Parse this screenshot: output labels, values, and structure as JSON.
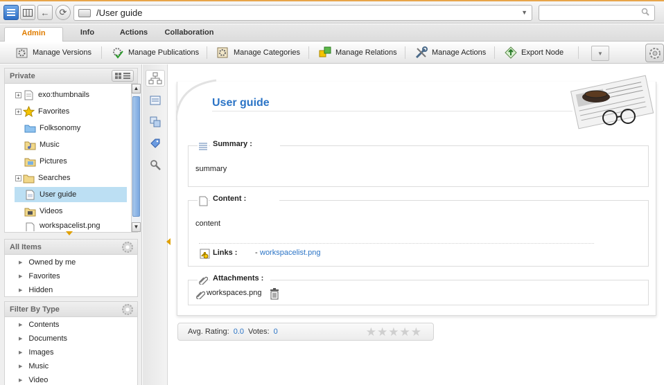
{
  "address": {
    "path": "/User guide",
    "search_placeholder": ""
  },
  "tabs": [
    {
      "label": "Admin"
    },
    {
      "label": "Info"
    },
    {
      "label": "Actions"
    },
    {
      "label": "Collaboration"
    }
  ],
  "actions": [
    {
      "label": "Manage Versions",
      "icon": "versions-icon"
    },
    {
      "label": "Manage Publications",
      "icon": "publications-icon"
    },
    {
      "label": "Manage Categories",
      "icon": "categories-icon"
    },
    {
      "label": "Manage Relations",
      "icon": "relations-icon"
    },
    {
      "label": "Manage Actions",
      "icon": "wrench-icon"
    },
    {
      "label": "Export Node",
      "icon": "export-icon"
    }
  ],
  "left": {
    "drive_title": "Private",
    "tree": [
      {
        "label": "exo:thumbnails",
        "expandable": true
      },
      {
        "label": "Favorites",
        "expandable": true
      },
      {
        "label": "Folksonomy",
        "expandable": false
      },
      {
        "label": "Music",
        "expandable": false
      },
      {
        "label": "Pictures",
        "expandable": false
      },
      {
        "label": "Searches",
        "expandable": true
      },
      {
        "label": "User guide",
        "expandable": false,
        "selected": true
      },
      {
        "label": "Videos",
        "expandable": false
      },
      {
        "label": "workspacelist.png",
        "expandable": false
      }
    ],
    "all_items": {
      "title": "All Items",
      "items": [
        "Owned by me",
        "Favorites",
        "Hidden"
      ]
    },
    "filter_by_type": {
      "title": "Filter By Type",
      "items": [
        "Contents",
        "Documents",
        "Images",
        "Music",
        "Video"
      ]
    }
  },
  "document": {
    "title": "User guide",
    "summary_label": "Summary :",
    "summary_text": "summary",
    "content_label": "Content :",
    "content_text": "content",
    "links_label": "Links :",
    "links_prefix": "- ",
    "link_text": "workspacelist.png",
    "attachments_label": "Attachments :",
    "attachment_name": "workspaces.png"
  },
  "rating": {
    "avg_label": "Avg. Rating:",
    "avg_value": "0.0",
    "votes_label": "Votes:",
    "votes_value": "0",
    "stars": "★★★★★"
  },
  "colors": {
    "accent": "#2b74c6",
    "admin_tab": "#e07d00",
    "selection": "#bcdff3"
  }
}
